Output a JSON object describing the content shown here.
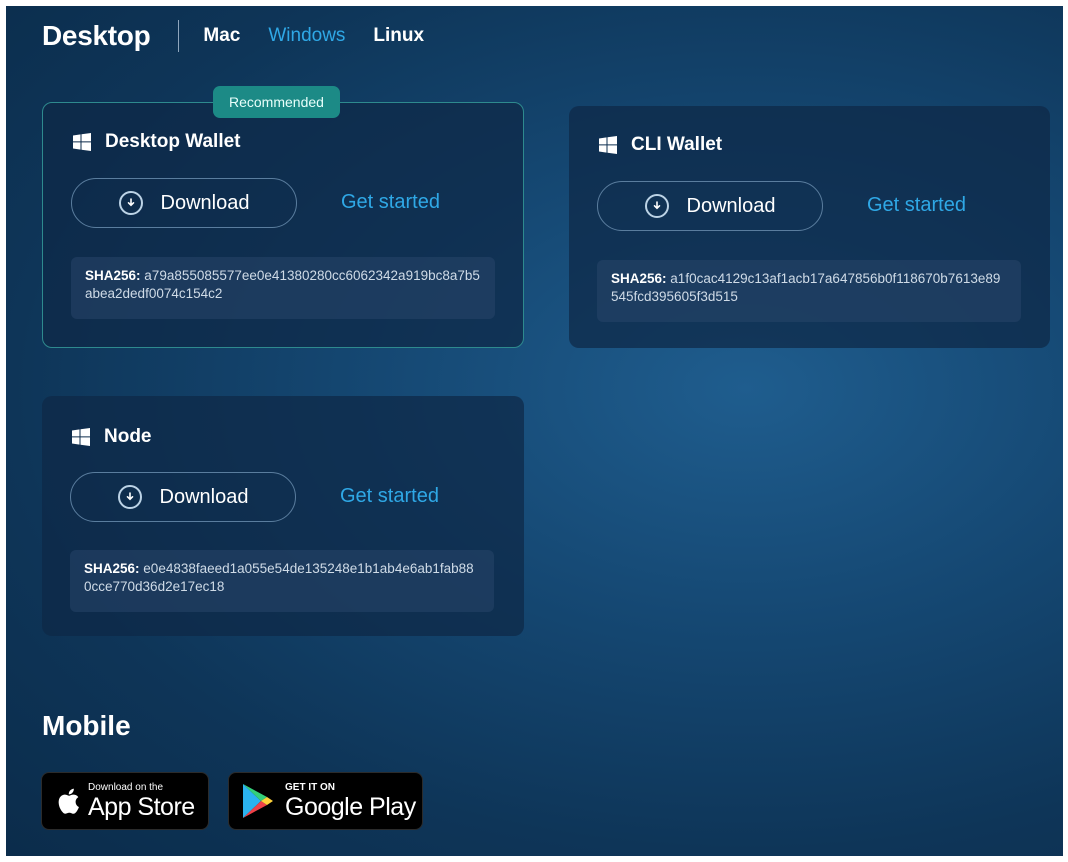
{
  "header": {
    "title": "Desktop",
    "tabs": [
      {
        "label": "Mac",
        "active": false
      },
      {
        "label": "Windows",
        "active": true
      },
      {
        "label": "Linux",
        "active": false
      }
    ]
  },
  "colors": {
    "accent": "#2fa8e6",
    "badge": "#1c8a86"
  },
  "cards": [
    {
      "badge": "Recommended",
      "title": "Desktop Wallet",
      "icon": "windows-icon",
      "download_label": "Download",
      "get_started_label": "Get started",
      "sha_label": "SHA256:",
      "sha_value": "a79a855085577ee0e41380280cc6062342a919bc8a7b5abea2dedf0074c154c2"
    },
    {
      "title": "CLI Wallet",
      "icon": "windows-icon",
      "download_label": "Download",
      "get_started_label": "Get started",
      "sha_label": "SHA256:",
      "sha_value": "a1f0cac4129c13af1acb17a647856b0f118670b7613e89545fcd395605f3d515"
    },
    {
      "title": "Node",
      "icon": "windows-icon",
      "download_label": "Download",
      "get_started_label": "Get started",
      "sha_label": "SHA256:",
      "sha_value": "e0e4838faeed1a055e54de135248e1b1ab4e6ab1fab880cce770d36d2e17ec18"
    }
  ],
  "mobile": {
    "title": "Mobile",
    "app_store": {
      "small": "Download on the",
      "big": "App Store"
    },
    "google_play": {
      "small": "GET IT ON",
      "big": "Google Play"
    }
  }
}
